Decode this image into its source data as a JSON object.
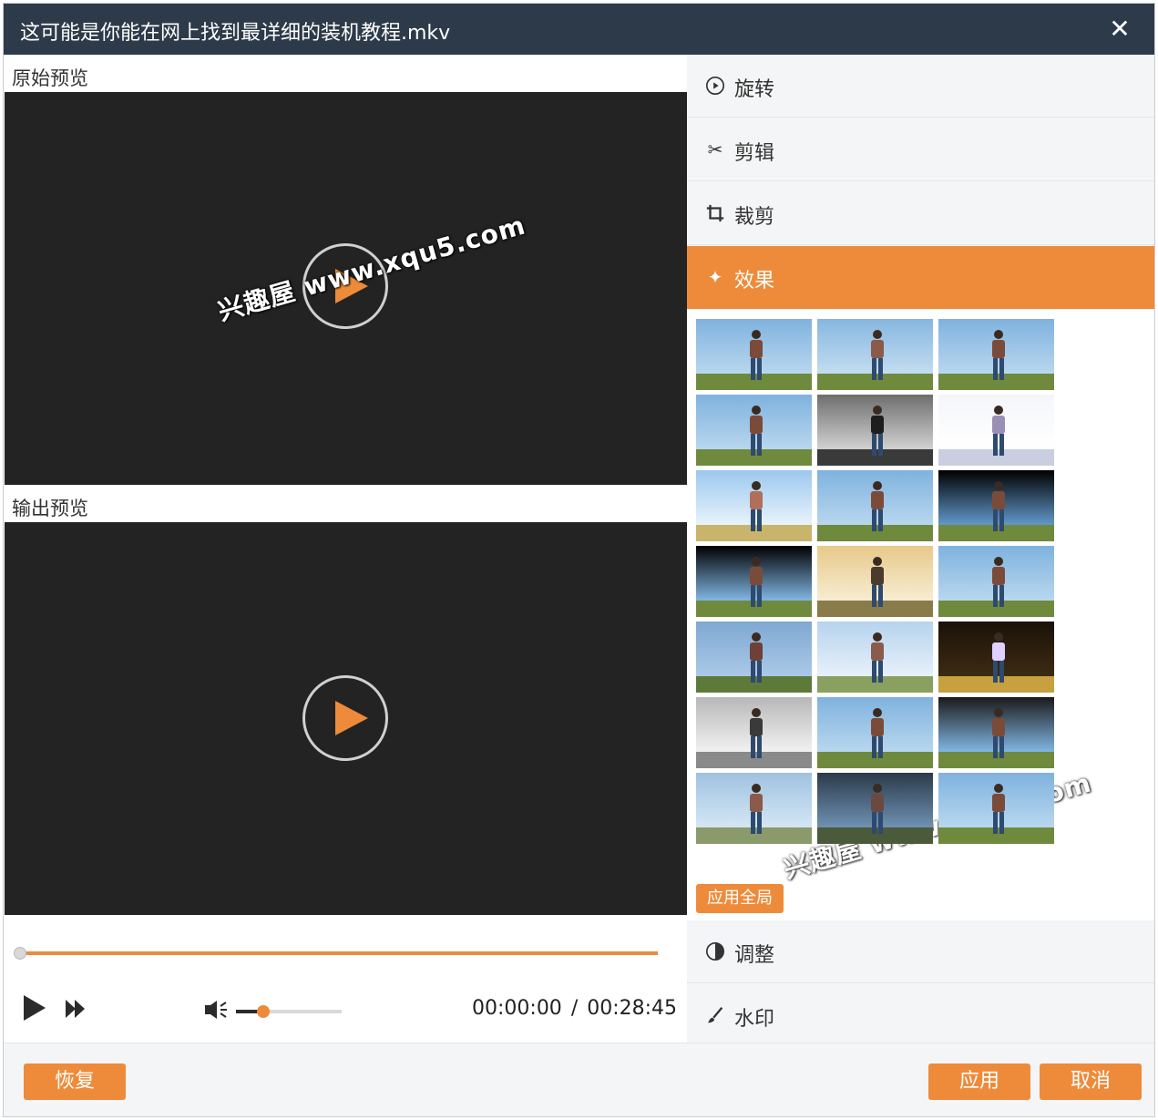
{
  "window": {
    "title": "这可能是你能在网上找到最详细的装机教程.mkv"
  },
  "preview": {
    "original_label": "原始预览",
    "output_label": "输出预览",
    "watermark": "兴趣屋 www.xqu5.com"
  },
  "controls": {
    "current_time": "00:00:00",
    "separator": "/",
    "total_time": "00:28:45",
    "seek_progress": 0.0,
    "volume_level": 0.26
  },
  "menu": {
    "rotate": "旋转",
    "trim": "剪辑",
    "crop": "裁剪",
    "effects": "效果",
    "adjust": "调整",
    "watermark": "水印"
  },
  "effects": {
    "apply_all": "应用全局",
    "count": 21
  },
  "footer": {
    "reset": "恢复",
    "apply": "应用",
    "cancel": "取消"
  },
  "colors": {
    "accent": "#ee8b3a",
    "titlebar": "#2d3a4a",
    "video_bg": "#232323"
  }
}
